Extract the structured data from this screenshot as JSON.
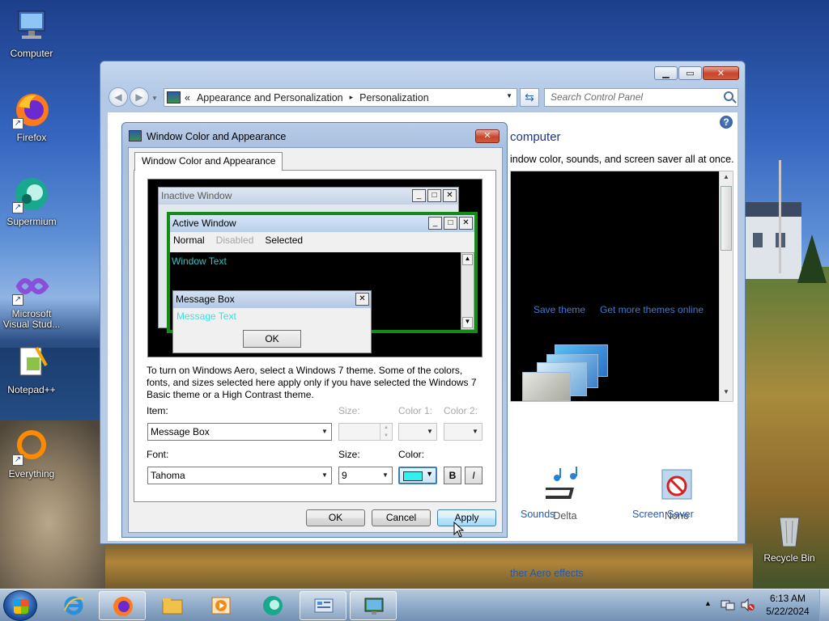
{
  "desktop": {
    "icons": [
      {
        "label": "Computer"
      },
      {
        "label": "Firefox"
      },
      {
        "label": "Supermium"
      },
      {
        "label": "Microsoft Visual Stud..."
      },
      {
        "label": "Notepad++"
      },
      {
        "label": "Everything"
      },
      {
        "label": "Recycle Bin"
      }
    ]
  },
  "personalization_window": {
    "breadcrumb_prefix": "«",
    "breadcrumb": [
      "Appearance and Personalization",
      "Personalization"
    ],
    "breadcrumb_sep": "▸",
    "search_placeholder": "Search Control Panel",
    "heading": "computer",
    "description": "indow color, sounds, and screen saver all at once.",
    "save_theme": "Save theme",
    "get_more_themes": "Get more themes online",
    "sounds_label": "Sounds",
    "sounds_value": "Delta",
    "screensaver_label": "Screen Saver",
    "screensaver_value": "None",
    "aero_link": "ther Aero effects",
    "help": "?"
  },
  "dialog": {
    "title": "Window Color and Appearance",
    "tab": "Window Color and Appearance",
    "preview": {
      "inactive_title": "Inactive Window",
      "active_title": "Active Window",
      "menu_normal": "Normal",
      "menu_disabled": "Disabled",
      "menu_selected": "Selected",
      "window_text": "Window Text",
      "msgbox_title": "Message Box",
      "msgbox_text": "Message Text",
      "msgbox_ok": "OK"
    },
    "info": "To turn on Windows Aero, select a Windows 7 theme.  Some of the colors, fonts, and sizes selected here apply only if you have selected the Windows 7 Basic theme or a High Contrast theme.",
    "item_label": "Item:",
    "item_value": "Message Box",
    "size_label": "Size:",
    "color1_label": "Color 1:",
    "color2_label": "Color 2:",
    "font_label": "Font:",
    "font_value": "Tahoma",
    "font_size_label": "Size:",
    "font_size_value": "9",
    "color_label": "Color:",
    "font_color": "#33f0f0",
    "bold": "B",
    "italic": "I",
    "ok": "OK",
    "cancel": "Cancel",
    "apply": "Apply"
  },
  "taskbar": {
    "time": "6:13 AM",
    "date": "5/22/2024",
    "pinned": [
      "internet-explorer",
      "firefox",
      "file-explorer",
      "media-player",
      "supermium",
      "control-panel",
      "personalization"
    ]
  },
  "colors": {
    "active_border": "#168a16",
    "window_text": "#2ec6c6",
    "link": "#1e5bb4"
  }
}
